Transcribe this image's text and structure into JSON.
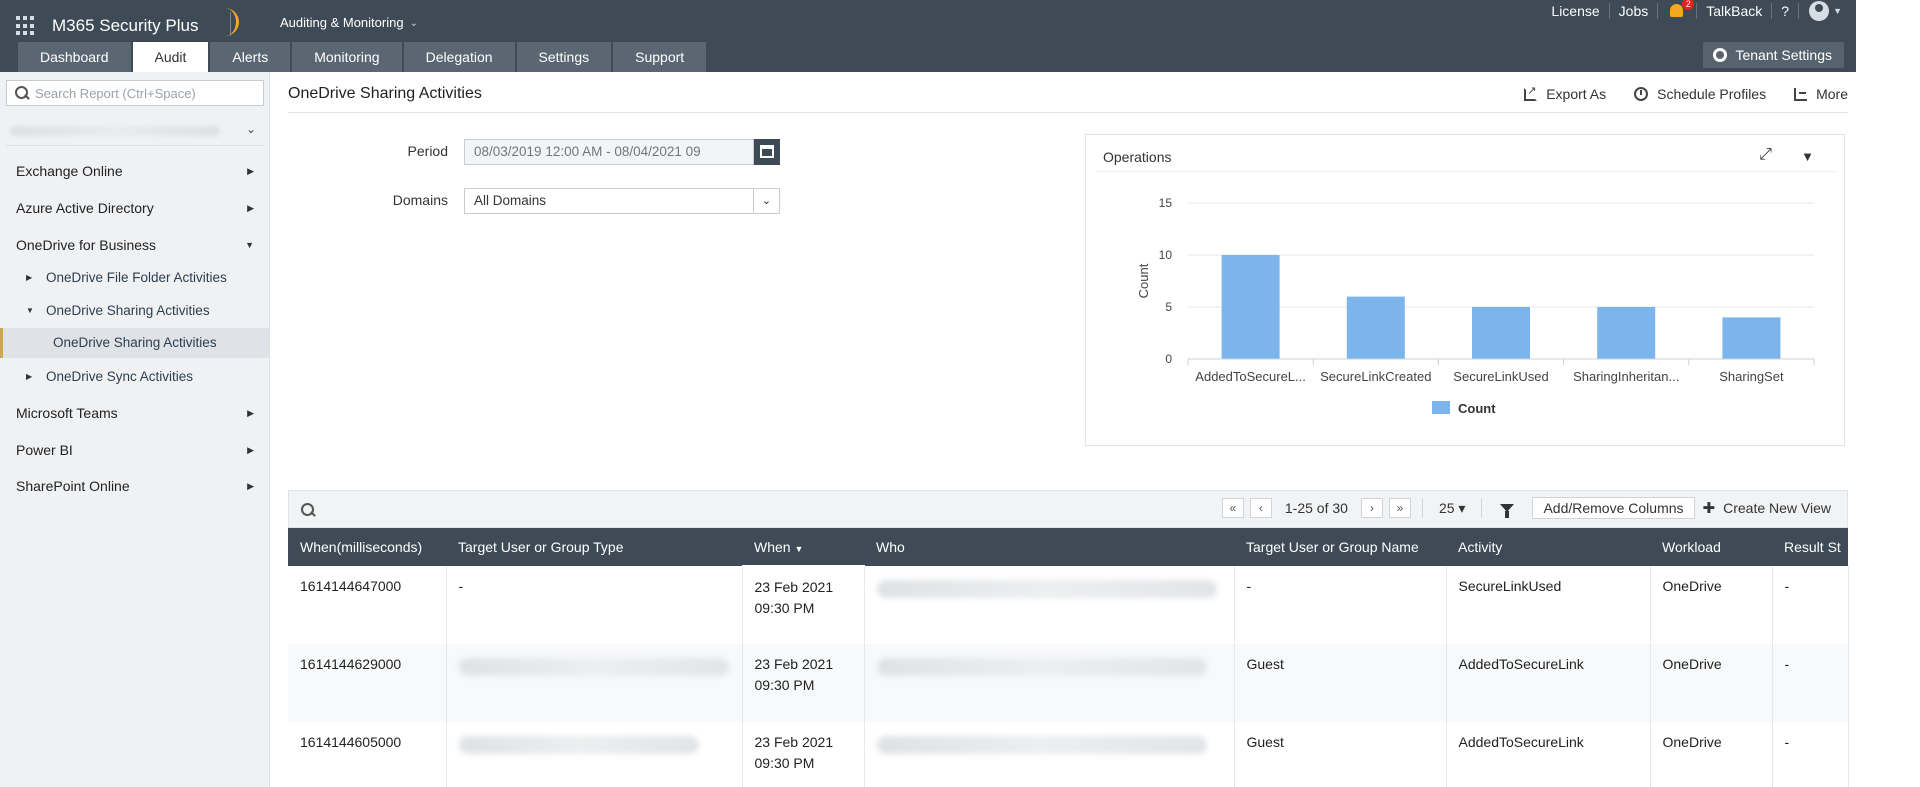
{
  "header": {
    "brand": "M365 Security Plus",
    "module": "Auditing & Monitoring",
    "links": [
      "License",
      "Jobs",
      "TalkBack",
      "?"
    ],
    "notifications": "2",
    "accent": "#f5a623",
    "bg": "#3e4a56"
  },
  "nav_tabs": [
    {
      "label": "Dashboard"
    },
    {
      "label": "Audit",
      "active": true
    },
    {
      "label": "Alerts"
    },
    {
      "label": "Monitoring"
    },
    {
      "label": "Delegation"
    },
    {
      "label": "Settings"
    },
    {
      "label": "Support"
    }
  ],
  "tenant_settings": "Tenant Settings",
  "sidebar": {
    "search_placeholder": "Search Report (Ctrl+Space)",
    "items": [
      {
        "label": "Exchange Online"
      },
      {
        "label": "Azure Active Directory"
      },
      {
        "label": "OneDrive for Business"
      },
      {
        "label": "OneDrive File Folder Activities"
      },
      {
        "label": "OneDrive Sharing Activities"
      },
      {
        "label": "OneDrive Sharing Activities"
      },
      {
        "label": "OneDrive Sync Activities"
      },
      {
        "label": "Microsoft Teams"
      },
      {
        "label": "Power BI"
      },
      {
        "label": "SharePoint Online"
      }
    ]
  },
  "page": {
    "title": "OneDrive Sharing Activities",
    "actions": [
      "Export As",
      "Schedule Profiles",
      "More"
    ],
    "period_label": "Period",
    "period_value": "08/03/2019 12:00 AM - 08/04/2021 09",
    "domains_label": "Domains",
    "domains_value": "All Domains"
  },
  "chart_panel_title": "Operations",
  "chart_data": {
    "type": "bar",
    "title": "",
    "categories": [
      "AddedToSecureL...",
      "SecureLinkCreated",
      "SecureLinkUsed",
      "SharingInheritan...",
      "SharingSet"
    ],
    "series": [
      {
        "name": "Count",
        "values": [
          10,
          6,
          5,
          5,
          4
        ]
      }
    ],
    "xlabel": "",
    "ylabel": "Count",
    "ylim": [
      0,
      15
    ],
    "yticks": [
      0,
      5,
      10,
      15
    ],
    "grid": true,
    "legend": "bottom",
    "color": "#7cb5ec"
  },
  "table_toolbar": {
    "range": "1-25 of 30",
    "page_size": "25",
    "add_remove": "Add/Remove Columns",
    "create_view": "Create New View"
  },
  "table": {
    "columns": [
      "When(milliseconds)",
      "Target User or Group Type",
      "When",
      "Who",
      "Target User or Group Name",
      "Activity",
      "Workload",
      "Result St"
    ],
    "rows": [
      {
        "ms": "1614144647000",
        "type": "-",
        "date": "23 Feb 2021",
        "time": "09:30 PM",
        "name": "-",
        "activity": "SecureLinkUsed",
        "workload": "OneDrive",
        "result": "-"
      },
      {
        "ms": "1614144629000",
        "type": "",
        "date": "23 Feb 2021",
        "time": "09:30 PM",
        "name": "Guest",
        "activity": "AddedToSecureLink",
        "workload": "OneDrive",
        "result": "-"
      },
      {
        "ms": "1614144605000",
        "type": "",
        "date": "23 Feb 2021",
        "time": "09:30 PM",
        "name": "Guest",
        "activity": "AddedToSecureLink",
        "workload": "OneDrive",
        "result": "-"
      }
    ]
  }
}
